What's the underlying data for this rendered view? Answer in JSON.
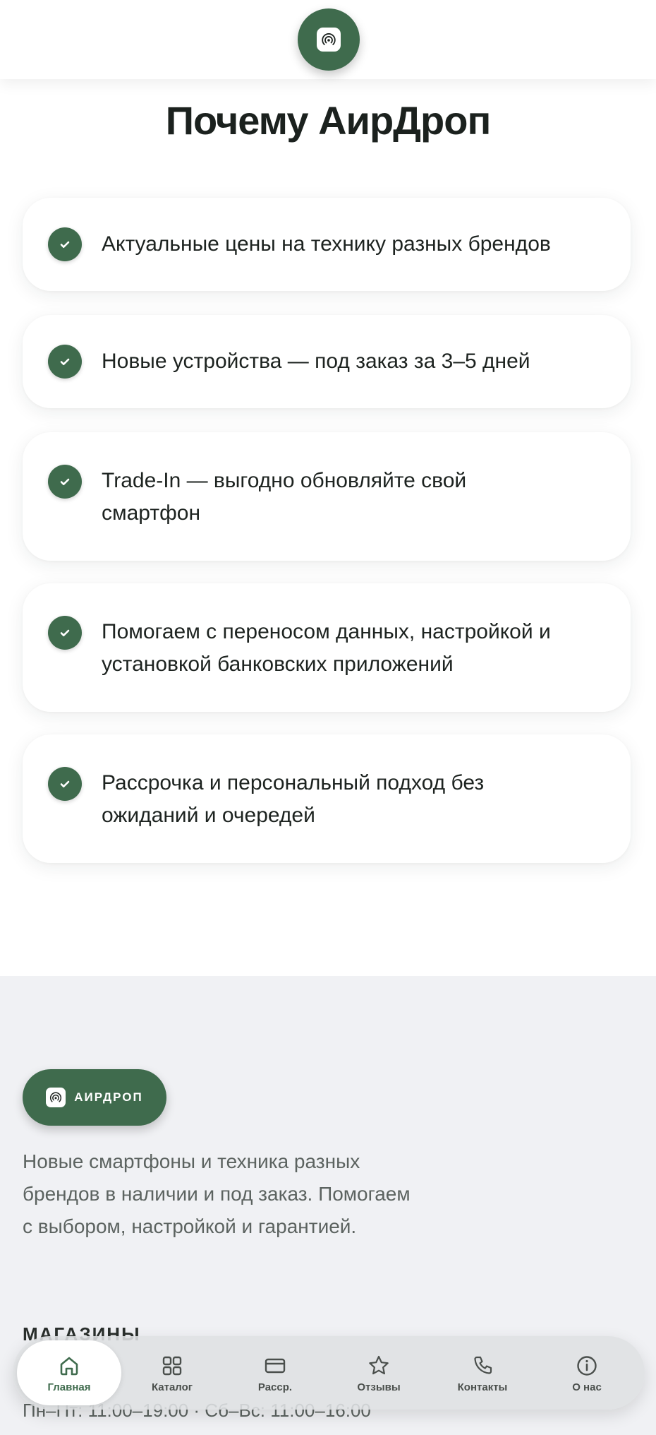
{
  "header": {
    "logo_icon": "airdrop-signal-icon"
  },
  "why": {
    "title": "Почему АирДроп",
    "items": [
      "Актуальные цены на технику разных брендов",
      "Новые устройства — под заказ за 3–5 дней",
      "Trade-In — выгодно обновляйте свой смартфон",
      "Помогаем с переносом данных, настройкой и установкой банковских приложений",
      "Рассрочка и персональный подход без ожиданий и очередей"
    ]
  },
  "footer": {
    "brand": "АИРДРОП",
    "description": "Новые смартфоны и техника разных брендов в наличии и под заказ. Помогаем с выбором, настройкой и гарантией.",
    "stores_heading": "МАГАЗИНЫ",
    "hours": "Пн–Пт: 11:00–19:00 · Сб–Вс: 11:00–16:00"
  },
  "nav": {
    "items": [
      {
        "label": "Главная",
        "icon": "home-icon"
      },
      {
        "label": "Каталог",
        "icon": "grid-icon"
      },
      {
        "label": "Расср.",
        "icon": "card-icon"
      },
      {
        "label": "Отзывы",
        "icon": "star-icon"
      },
      {
        "label": "Контакты",
        "icon": "phone-icon"
      },
      {
        "label": "О нас",
        "icon": "info-icon"
      }
    ],
    "active_index": 0
  },
  "colors": {
    "accent": "#3f6b4d",
    "footer_bg": "#f0f1f4",
    "nav_bg": "#dee0e3"
  }
}
